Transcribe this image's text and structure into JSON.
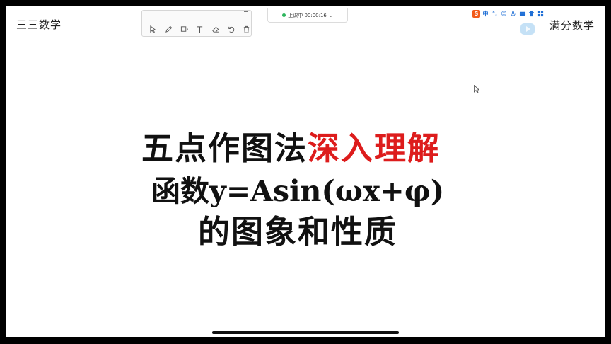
{
  "brand": {
    "left": "三三数学",
    "right": "满分数学"
  },
  "live": {
    "status": "上课中 00:00:16"
  },
  "toolbar": {
    "tools": [
      "select-icon",
      "pen-icon",
      "shape-icon",
      "text-icon",
      "eraser-icon",
      "undo-icon",
      "trash-icon"
    ]
  },
  "tray": {
    "items": [
      {
        "name": "sogou-ime-icon",
        "glyph": "S"
      },
      {
        "name": "chinese-mode-icon",
        "glyph": "中"
      },
      {
        "name": "punctuation-icon",
        "glyph": "°,"
      },
      {
        "name": "emoji-icon",
        "glyph": "☺"
      },
      {
        "name": "microphone-icon",
        "glyph": "🎙"
      },
      {
        "name": "keyboard-icon",
        "glyph": "⌨"
      },
      {
        "name": "skin-icon",
        "glyph": "👕"
      },
      {
        "name": "toolbox-icon",
        "glyph": "▦"
      }
    ]
  },
  "slide": {
    "line1_black": "五点作图法",
    "line1_red": "深入理解",
    "line2": "函数y=Asin(ωx+φ)",
    "line3": "的图象和性质"
  },
  "colors": {
    "accent_red": "#dd1c1c",
    "live_green": "#2db55d"
  }
}
